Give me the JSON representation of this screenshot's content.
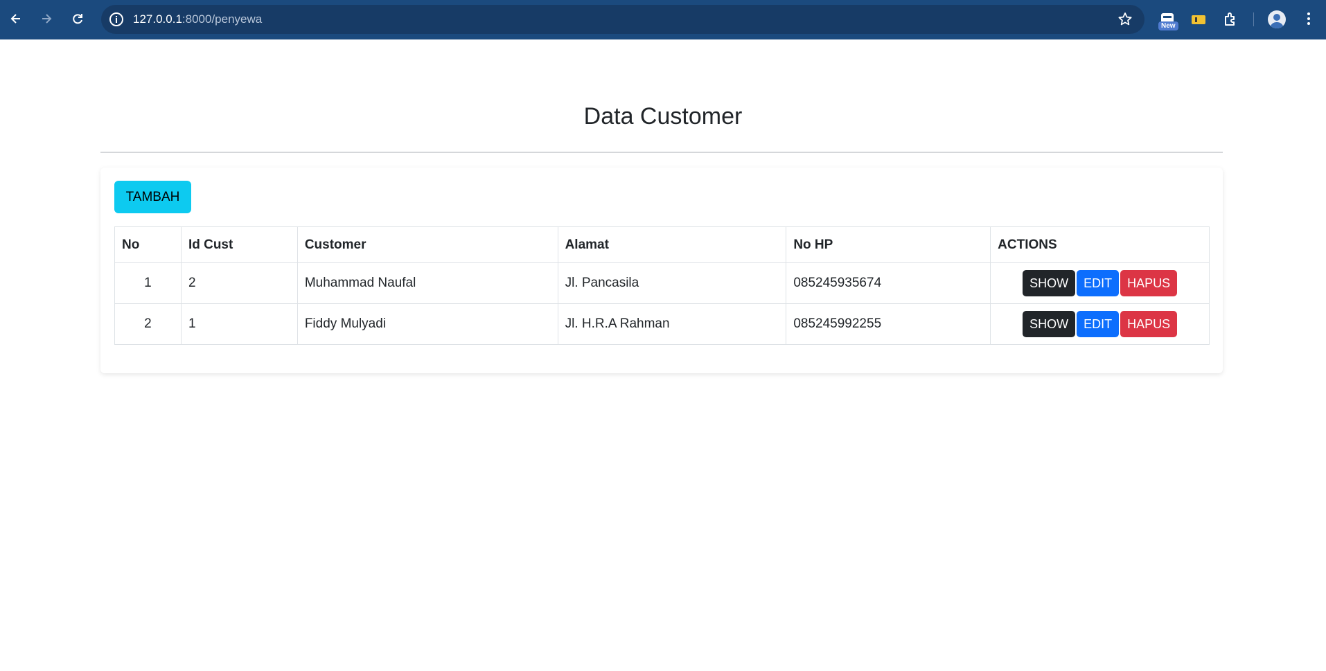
{
  "browser": {
    "url_host": "127.0.0.1",
    "url_rest": ":8000/penyewa",
    "new_badge": "New"
  },
  "page": {
    "title": "Data Customer",
    "add_button": "TAMBAH"
  },
  "table": {
    "headers": [
      "No",
      "Id Cust",
      "Customer",
      "Alamat",
      "No HP",
      "ACTIONS"
    ],
    "rows": [
      {
        "no": "1",
        "id": "2",
        "customer": "Muhammad Naufal",
        "alamat": "Jl. Pancasila",
        "hp": "085245935674"
      },
      {
        "no": "2",
        "id": "1",
        "customer": "Fiddy Mulyadi",
        "alamat": "Jl. H.R.A Rahman",
        "hp": "085245992255"
      }
    ],
    "actions": {
      "show": "SHOW",
      "edit": "EDIT",
      "hapus": "HAPUS"
    }
  },
  "colors": {
    "chrome": "#1b4a7e",
    "add_button": "#0dcaf0",
    "show": "#212529",
    "edit": "#0d6efd",
    "hapus": "#dc3545"
  }
}
